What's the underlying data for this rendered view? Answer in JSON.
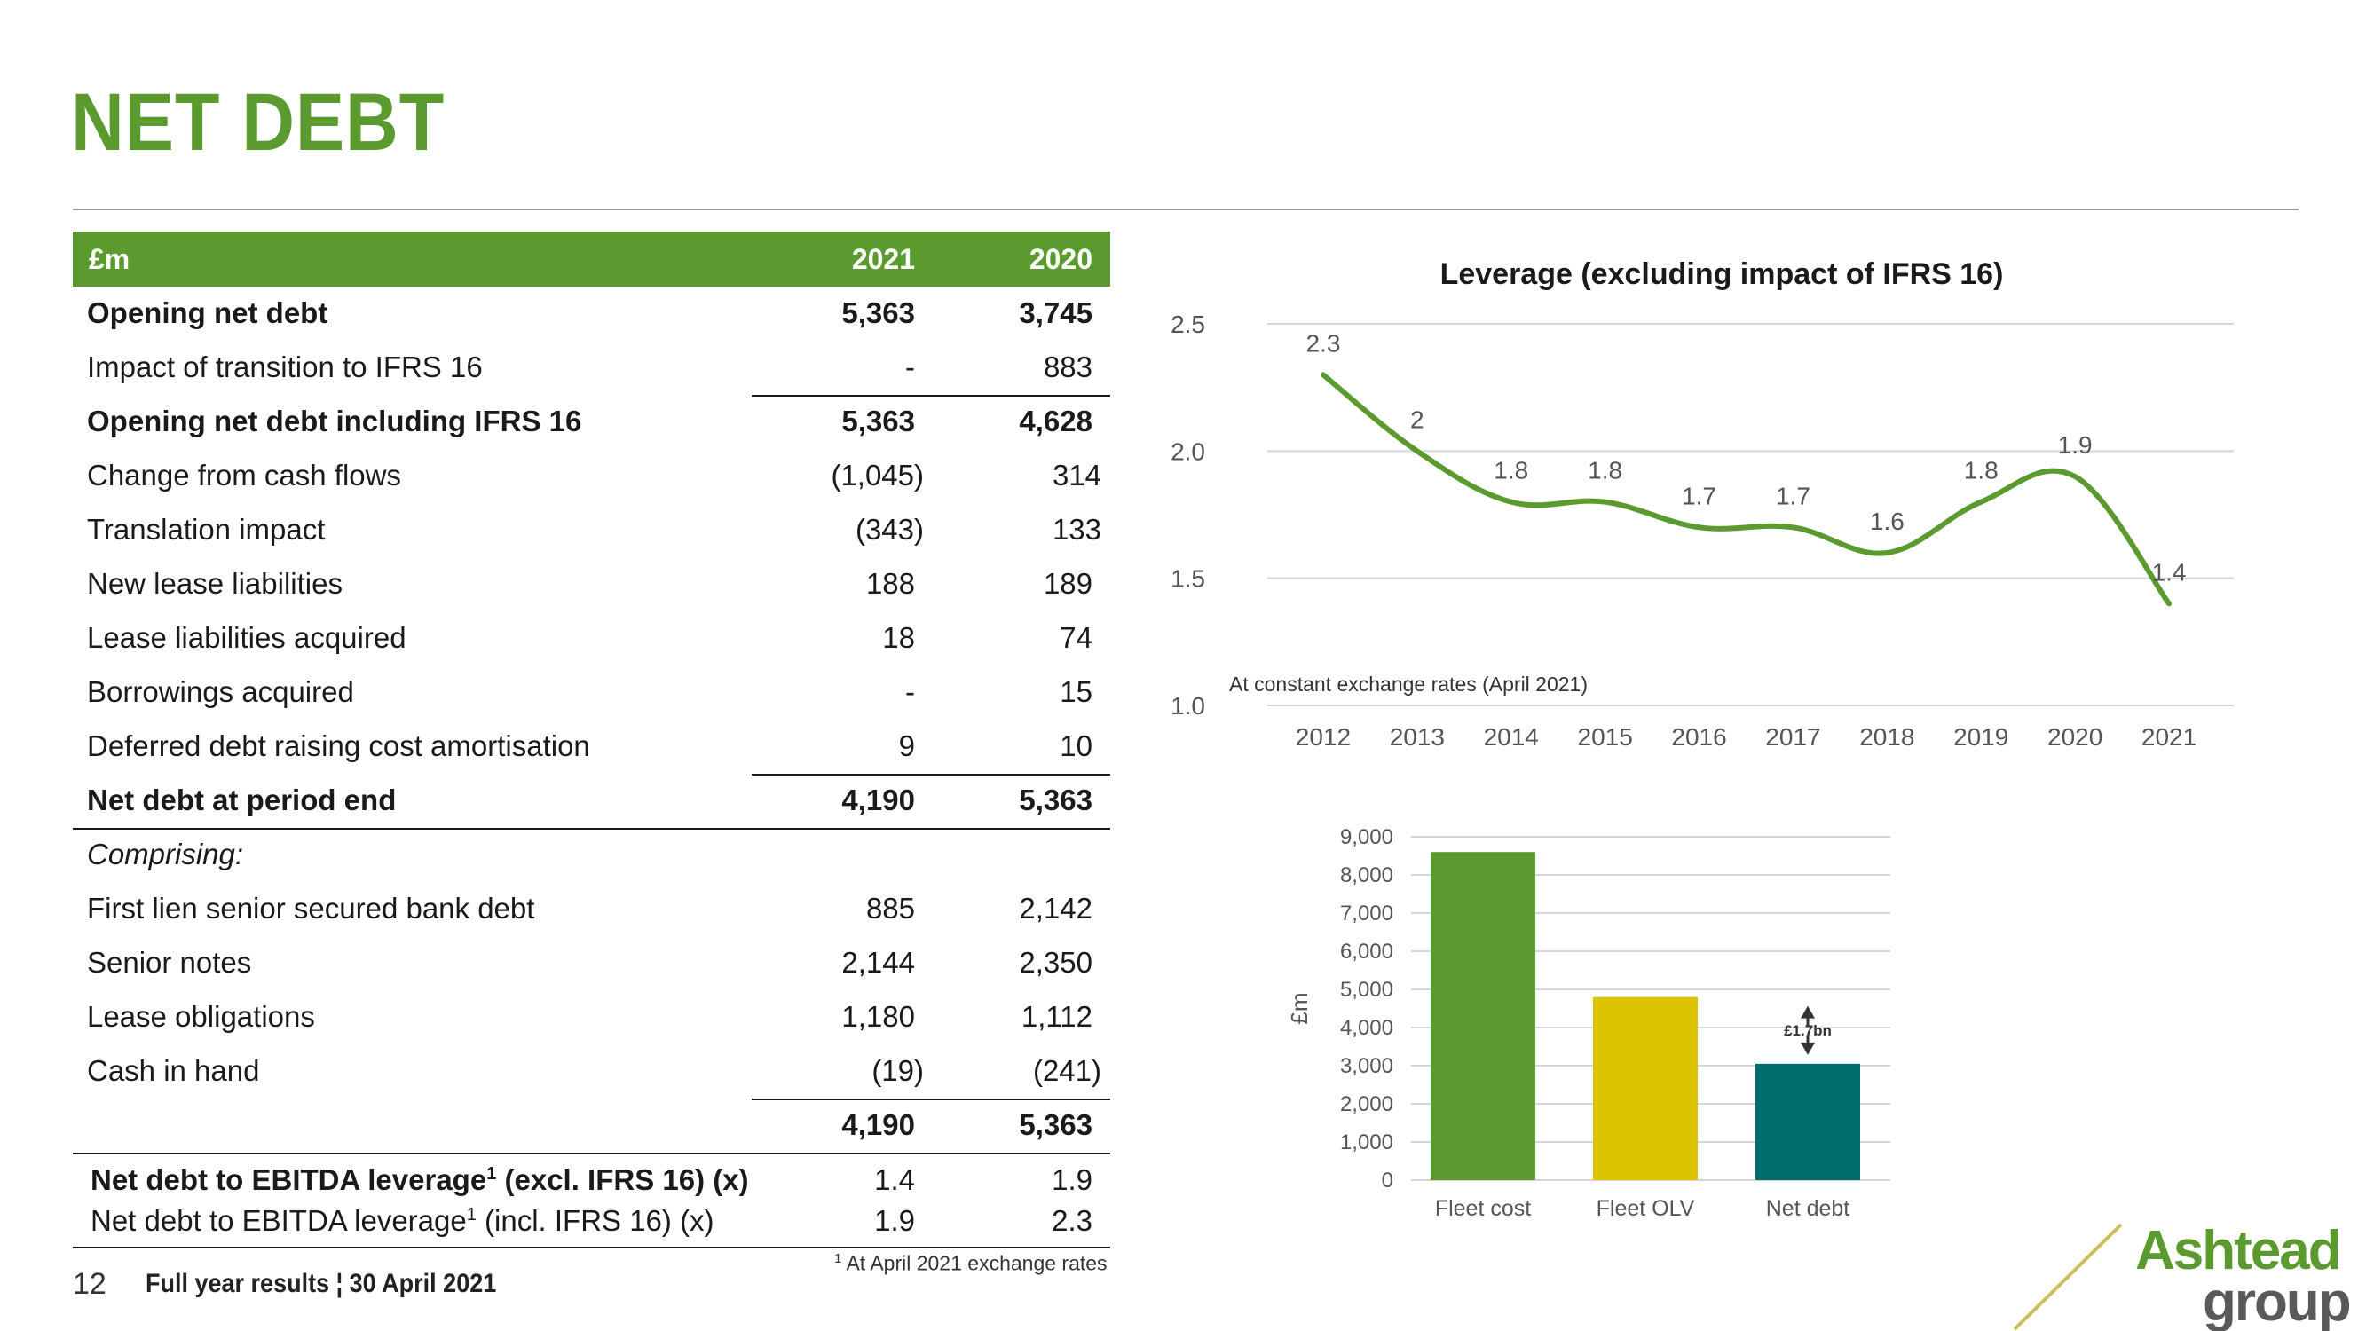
{
  "slide": {
    "title": "NET DEBT",
    "page_number": "12",
    "footer": "Full year results ¦ 30 April 2021",
    "footnote_marker": "1",
    "footnote": "At April 2021 exchange rates",
    "logo_top": "Ashtead",
    "logo_bottom": "group"
  },
  "table": {
    "header": {
      "label": "£m",
      "y2021": "2021",
      "y2020": "2020"
    },
    "rows": [
      {
        "label": "Opening net debt",
        "v2021": "5,363",
        "v2020": "3,745",
        "bold": true
      },
      {
        "label": "Impact of transition to IFRS 16",
        "v2021": "-",
        "v2020": "883"
      },
      {
        "label": "Opening net debt including IFRS 16",
        "v2021": "5,363",
        "v2020": "4,628",
        "bold": true
      },
      {
        "label": "Change from cash flows",
        "v2021": "(1,045)",
        "v2020": "314"
      },
      {
        "label": "Translation impact",
        "v2021": "(343)",
        "v2020": "133"
      },
      {
        "label": "New lease liabilities",
        "v2021": "188",
        "v2020": "189"
      },
      {
        "label": "Lease liabilities acquired",
        "v2021": "18",
        "v2020": "74"
      },
      {
        "label": "Borrowings acquired",
        "v2021": "-",
        "v2020": "15"
      },
      {
        "label": "Deferred debt raising cost amortisation",
        "v2021": "9",
        "v2020": "10"
      },
      {
        "label": "Net debt at period end",
        "v2021": "4,190",
        "v2020": "5,363",
        "bold": true
      },
      {
        "label": "Comprising:",
        "v2021": "",
        "v2020": "",
        "italic": true
      },
      {
        "label": "First lien senior secured bank debt",
        "v2021": "885",
        "v2020": "2,142"
      },
      {
        "label": "Senior notes",
        "v2021": "2,144",
        "v2020": "2,350"
      },
      {
        "label": "Lease obligations",
        "v2021": "1,180",
        "v2020": "1,112"
      },
      {
        "label": "Cash in hand",
        "v2021": "(19)",
        "v2020": "(241)"
      },
      {
        "label": "",
        "v2021": "4,190",
        "v2020": "5,363",
        "bold": true
      }
    ],
    "leverage_rows": [
      {
        "label_pre": "Net debt to EBITDA leverage",
        "sup": "1",
        "label_post": " (excl. IFRS 16) (x)",
        "v2021": "1.4",
        "v2020": "1.9",
        "bold": true
      },
      {
        "label_pre": "Net debt to EBITDA leverage",
        "sup": "1",
        "label_post": " (incl. IFRS 16) (x)",
        "v2021": "1.9",
        "v2020": "2.3",
        "bold": false
      }
    ]
  },
  "chart_data": [
    {
      "type": "line",
      "title": "Leverage (excluding impact of IFRS 16)",
      "note": "At constant exchange rates (April 2021)",
      "x": [
        "2012",
        "2013",
        "2014",
        "2015",
        "2016",
        "2017",
        "2018",
        "2019",
        "2020",
        "2021"
      ],
      "series": [
        {
          "values": [
            2.3,
            2.0,
            1.8,
            1.8,
            1.7,
            1.7,
            1.6,
            1.8,
            1.9,
            1.4
          ]
        }
      ],
      "ylim": [
        1.0,
        2.5
      ],
      "yticks": [
        "1.0",
        "1.5",
        "2.0",
        "2.5"
      ],
      "grid": true,
      "color": "#5b9a2e"
    },
    {
      "type": "bar",
      "categories": [
        "Fleet cost",
        "Fleet OLV",
        "Net debt"
      ],
      "values": [
        8600,
        4800,
        3050
      ],
      "colors": [
        "#5b9a2e",
        "#dcc400",
        "#006b6b"
      ],
      "ylabel": "£m",
      "ylim": [
        0,
        9000
      ],
      "yticks": [
        "0",
        "1,000",
        "2,000",
        "3,000",
        "4,000",
        "5,000",
        "6,000",
        "7,000",
        "8,000",
        "9,000"
      ],
      "annotation": "£1.7bn",
      "grid": true
    }
  ]
}
